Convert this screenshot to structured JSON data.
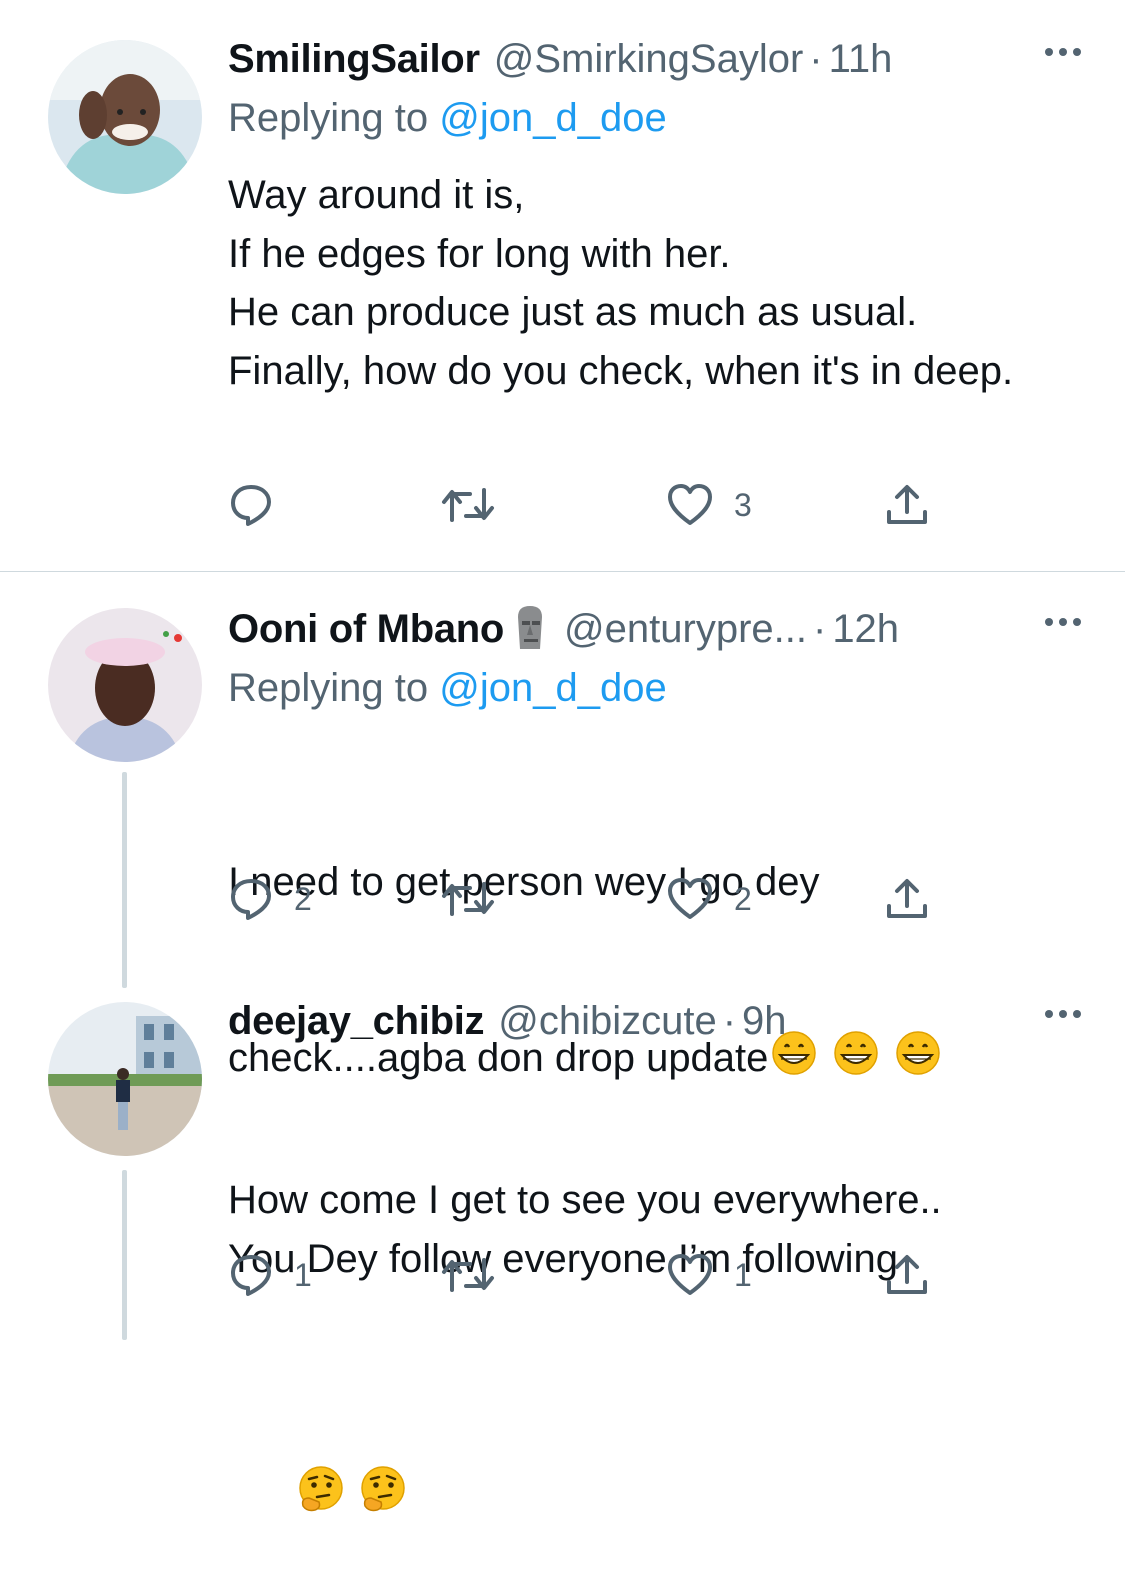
{
  "tweets": [
    {
      "name": "SmilingSailor",
      "handle": "@SmirkingSaylor",
      "time": "11h",
      "replying_prefix": "Replying to ",
      "replying_to": "@jon_d_doe",
      "body": "Way around it is,\nIf he edges for long with her.\nHe can produce just as much as usual.\nFinally, how do you check, when it's in deep.",
      "replies": "",
      "retweets": "",
      "likes": "3"
    },
    {
      "name": "Ooni of Mbano",
      "name_emoji": "moai-icon",
      "handle": "@enturypre...",
      "time": "12h",
      "replying_prefix": "Replying to ",
      "replying_to": "@jon_d_doe",
      "body_line1": "I need to get person wey I go dey",
      "body_line2": "check....agba don drop update",
      "body_emoji": "grinning-face-icon",
      "replies": "2",
      "retweets": "",
      "likes": "2"
    },
    {
      "name": "deejay_chibiz",
      "handle": "@chibizcute",
      "time": "9h",
      "body": "How come I get to see you everywhere..\nYou Dey follow everyone I’m following",
      "body_emoji": "thinking-face-icon",
      "replies": "1",
      "retweets": "",
      "likes": "1"
    }
  ],
  "separator_dot": "·",
  "colors": {
    "accent": "#1d9bf0",
    "secondary_text": "#536471",
    "divider": "#cfd9de"
  }
}
